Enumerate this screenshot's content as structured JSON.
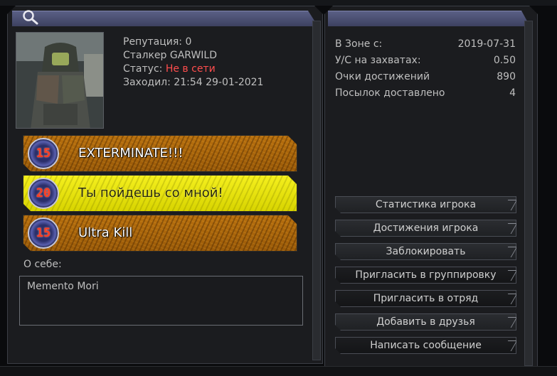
{
  "profile": {
    "reputation": "Репутация: 0",
    "stalker": "Сталкер GARWILD",
    "status_label": "Статус:",
    "status_value": "Не в сети",
    "last_seen": "Заходил: 21:54 29-01-2021"
  },
  "achievements": [
    {
      "level": "15",
      "label": "EXTERMINATE!!!",
      "style": "orange"
    },
    {
      "level": "20",
      "label": "Ты пойдешь со мной!",
      "style": "yellow"
    },
    {
      "level": "15",
      "label": "Ultra Kill",
      "style": "orange"
    }
  ],
  "about": {
    "label": "О себе:",
    "text": "Memento Mori"
  },
  "stats": [
    {
      "label": "В Зоне с:",
      "value": "2019-07-31"
    },
    {
      "label": "У/С на захватах:",
      "value": "0.50"
    },
    {
      "label": "Очки достижений",
      "value": "890"
    },
    {
      "label": "Посылок доставлено",
      "value": "4"
    }
  ],
  "buttons": {
    "stats": "Статистика игрока",
    "achievements": "Достижения игрока",
    "block": "Заблокировать",
    "invite_group": "Пригласить в группировку",
    "invite_squad": "Пригласить в отряд",
    "add_friend": "Добавить в друзья",
    "message": "Написать сообщение"
  },
  "colors": {
    "header": "#4a4e70",
    "status_offline": "#ff4d4d",
    "achievement_orange": "#a8650c",
    "achievement_yellow": "#e8e40f"
  },
  "icons": {
    "search": "magnifier"
  }
}
